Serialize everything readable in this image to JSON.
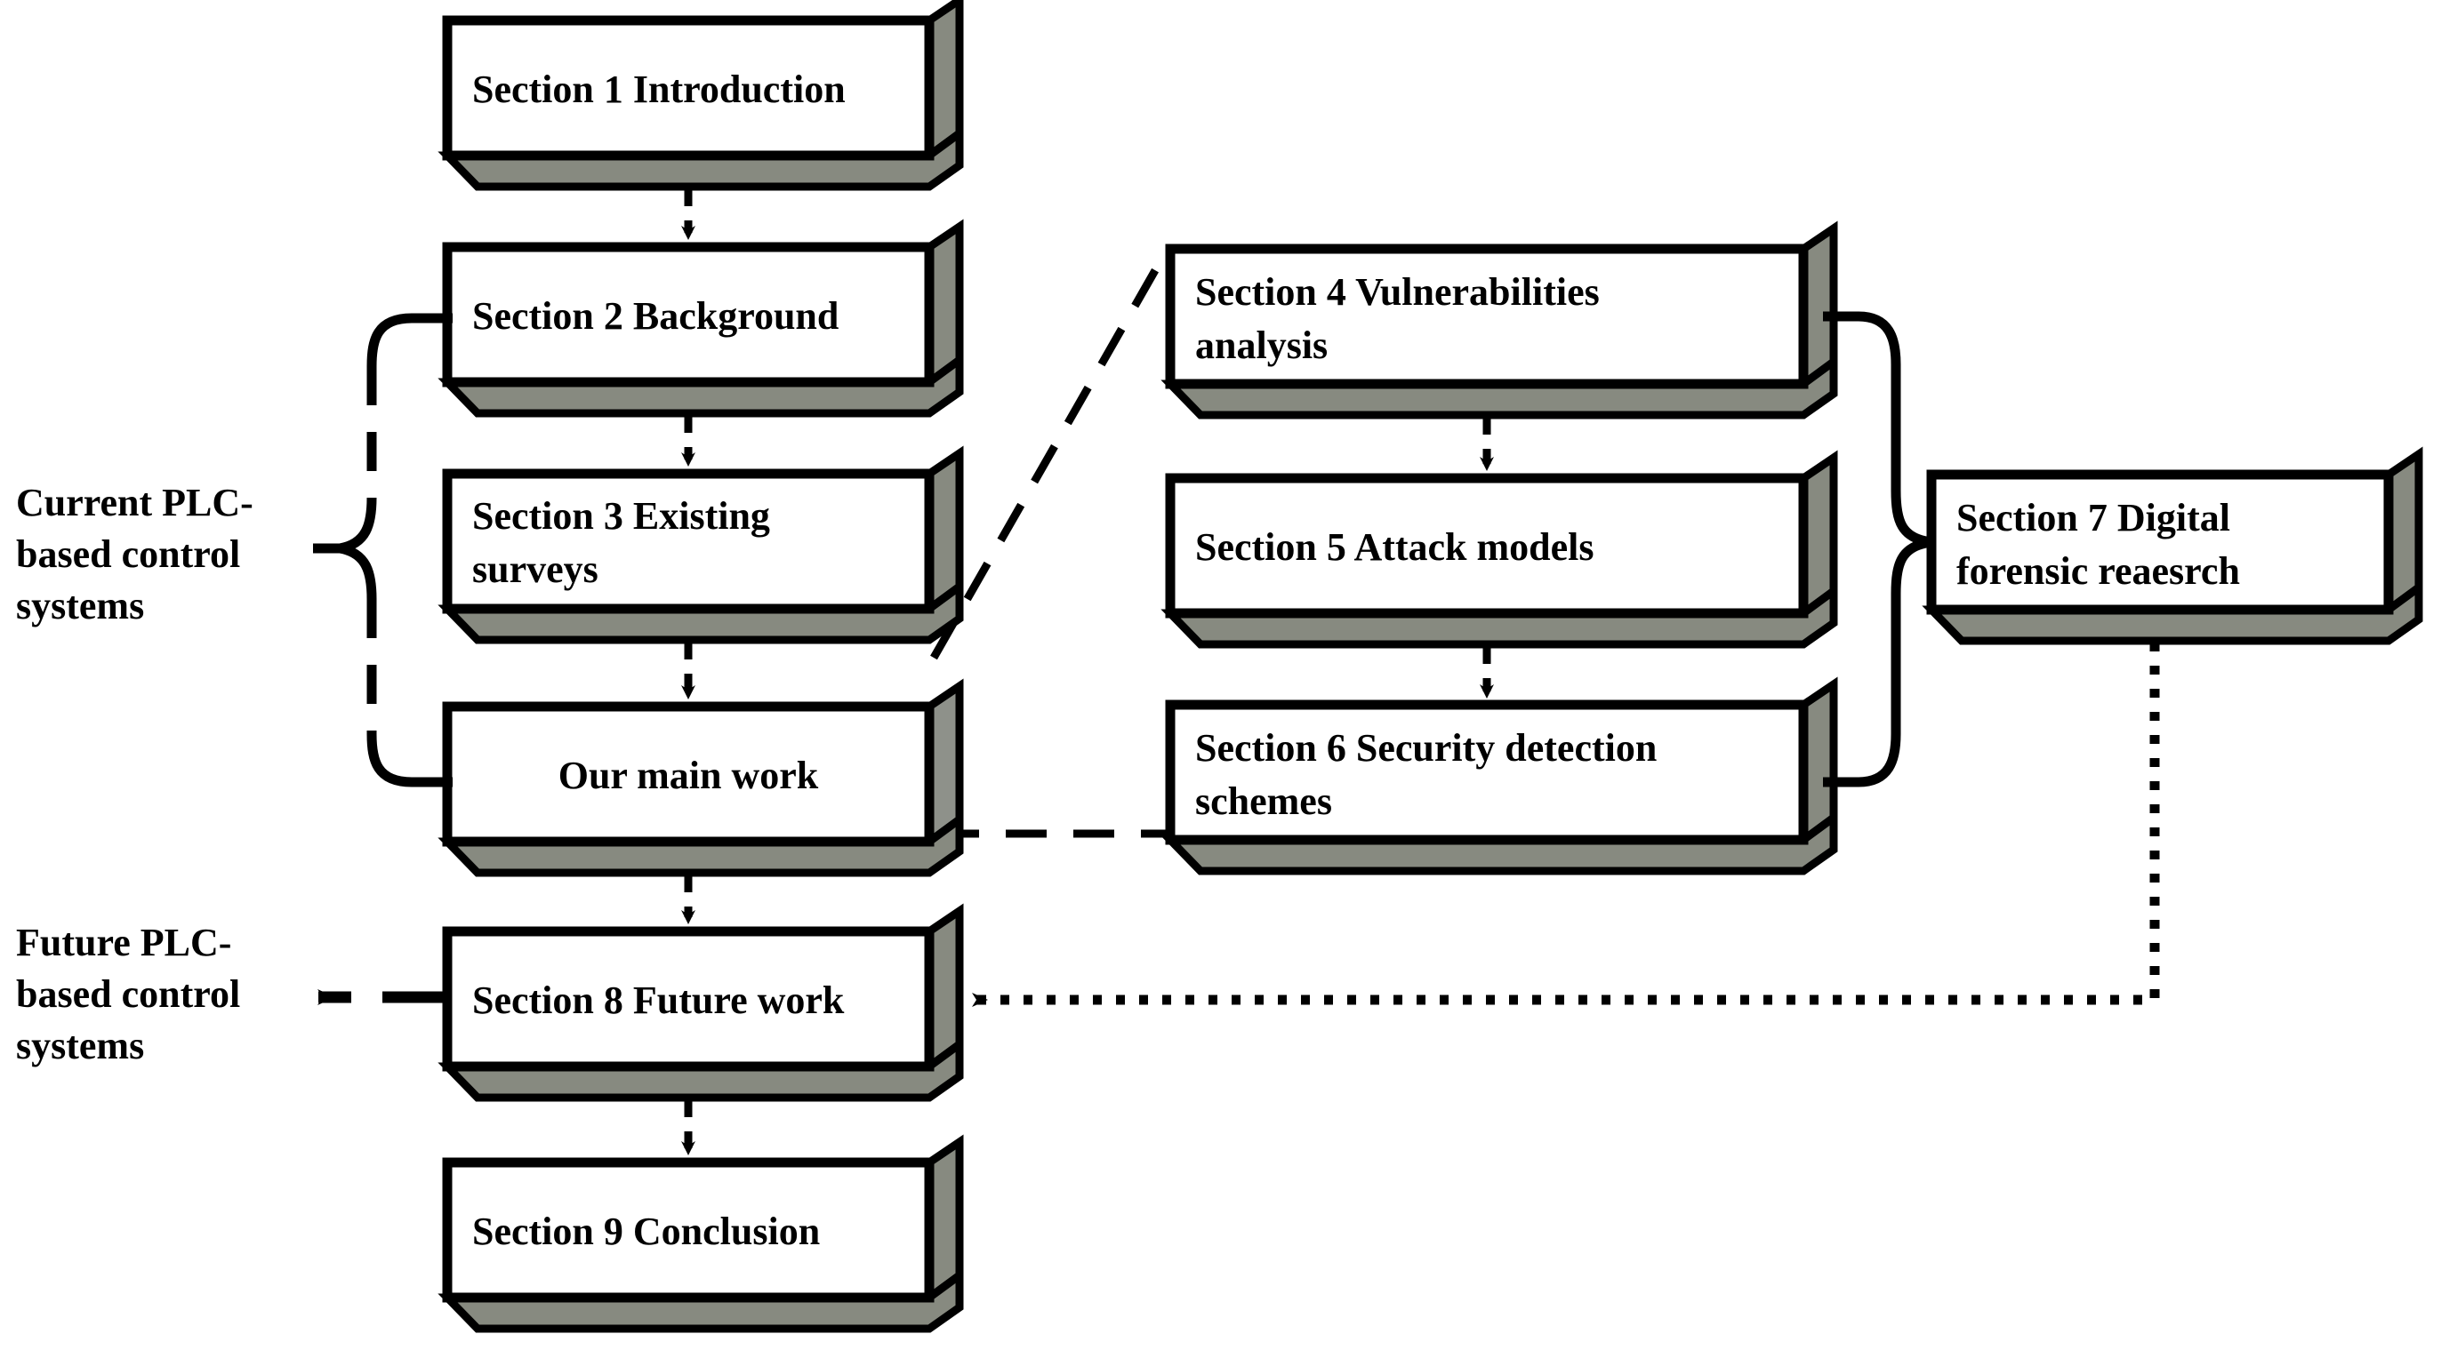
{
  "diagram": {
    "type": "flowchart",
    "title": "Paper organization flowchart",
    "colors": {
      "box_face": "#ffffff",
      "box_shade": "#878a80",
      "stroke": "#000000",
      "background": "#ffffff"
    },
    "nodes": [
      {
        "id": "s1",
        "label": "Section 1 Introduction",
        "lines": [
          "Section 1 Introduction"
        ],
        "align": "left",
        "column": "left"
      },
      {
        "id": "s2",
        "label": "Section 2 Background",
        "lines": [
          "Section 2 Background"
        ],
        "align": "left",
        "column": "left"
      },
      {
        "id": "s3",
        "label": "Section 3 Existing surveys",
        "lines": [
          "Section 3 Existing",
          "surveys"
        ],
        "align": "left",
        "column": "left"
      },
      {
        "id": "main",
        "label": "Our main work",
        "lines": [
          "Our main work"
        ],
        "align": "center",
        "column": "left"
      },
      {
        "id": "s8",
        "label": "Section 8 Future work",
        "lines": [
          "Section 8 Future work"
        ],
        "align": "left",
        "column": "left"
      },
      {
        "id": "s9",
        "label": "Section 9 Conclusion",
        "lines": [
          "Section 9 Conclusion"
        ],
        "align": "left",
        "column": "left"
      },
      {
        "id": "s4",
        "label": "Section 4 Vulnerabilities analysis",
        "lines": [
          "Section 4 Vulnerabilities",
          "analysis"
        ],
        "align": "left",
        "column": "middle"
      },
      {
        "id": "s5",
        "label": "Section 5 Attack models",
        "lines": [
          "Section 5 Attack models"
        ],
        "align": "left",
        "column": "middle"
      },
      {
        "id": "s6",
        "label": "Section 6 Security detection schemes",
        "lines": [
          "Section 6 Security detection",
          "schemes"
        ],
        "align": "left",
        "column": "middle"
      },
      {
        "id": "s7",
        "label": "Section 7 Digital forensic reaesrch",
        "lines": [
          "Section 7 Digital",
          "forensic reaesrch"
        ],
        "align": "left",
        "column": "right"
      }
    ],
    "annotations": [
      {
        "id": "current-plc",
        "lines": [
          "Current PLC-",
          "based control",
          "systems"
        ],
        "brace": "left-group-current"
      },
      {
        "id": "future-plc",
        "lines": [
          "Future PLC-",
          "based control",
          "systems"
        ],
        "arrow": "solid-left"
      }
    ],
    "edges": [
      {
        "from": "s1",
        "to": "s2",
        "style": "dashed",
        "arrow": true,
        "direction": "down"
      },
      {
        "from": "s2",
        "to": "s3",
        "style": "dashed",
        "arrow": true,
        "direction": "down"
      },
      {
        "from": "s3",
        "to": "main",
        "style": "dashed",
        "arrow": true,
        "direction": "down"
      },
      {
        "from": "main",
        "to": "s8",
        "style": "dashed",
        "arrow": true,
        "direction": "down"
      },
      {
        "from": "s8",
        "to": "s9",
        "style": "dashed",
        "arrow": true,
        "direction": "down"
      },
      {
        "from": "s4",
        "to": "s5",
        "style": "dashed",
        "arrow": true,
        "direction": "down"
      },
      {
        "from": "s5",
        "to": "s6",
        "style": "dashed",
        "arrow": true,
        "direction": "down"
      },
      {
        "from": "main",
        "to": "s4",
        "style": "long-dashed",
        "arrow": false,
        "direction": "diagonal-up-right"
      },
      {
        "from": "main",
        "to": "s6",
        "style": "long-dashed",
        "arrow": false,
        "direction": "right"
      },
      {
        "from": "s7",
        "to": "s8",
        "style": "dotted",
        "arrow": true,
        "direction": "down-then-left"
      },
      {
        "from": "group-456",
        "to": "s7",
        "style": "brace",
        "arrow": false,
        "direction": "right"
      },
      {
        "from": "s8",
        "to": "future-plc",
        "style": "solid",
        "arrow": true,
        "direction": "left"
      }
    ]
  }
}
